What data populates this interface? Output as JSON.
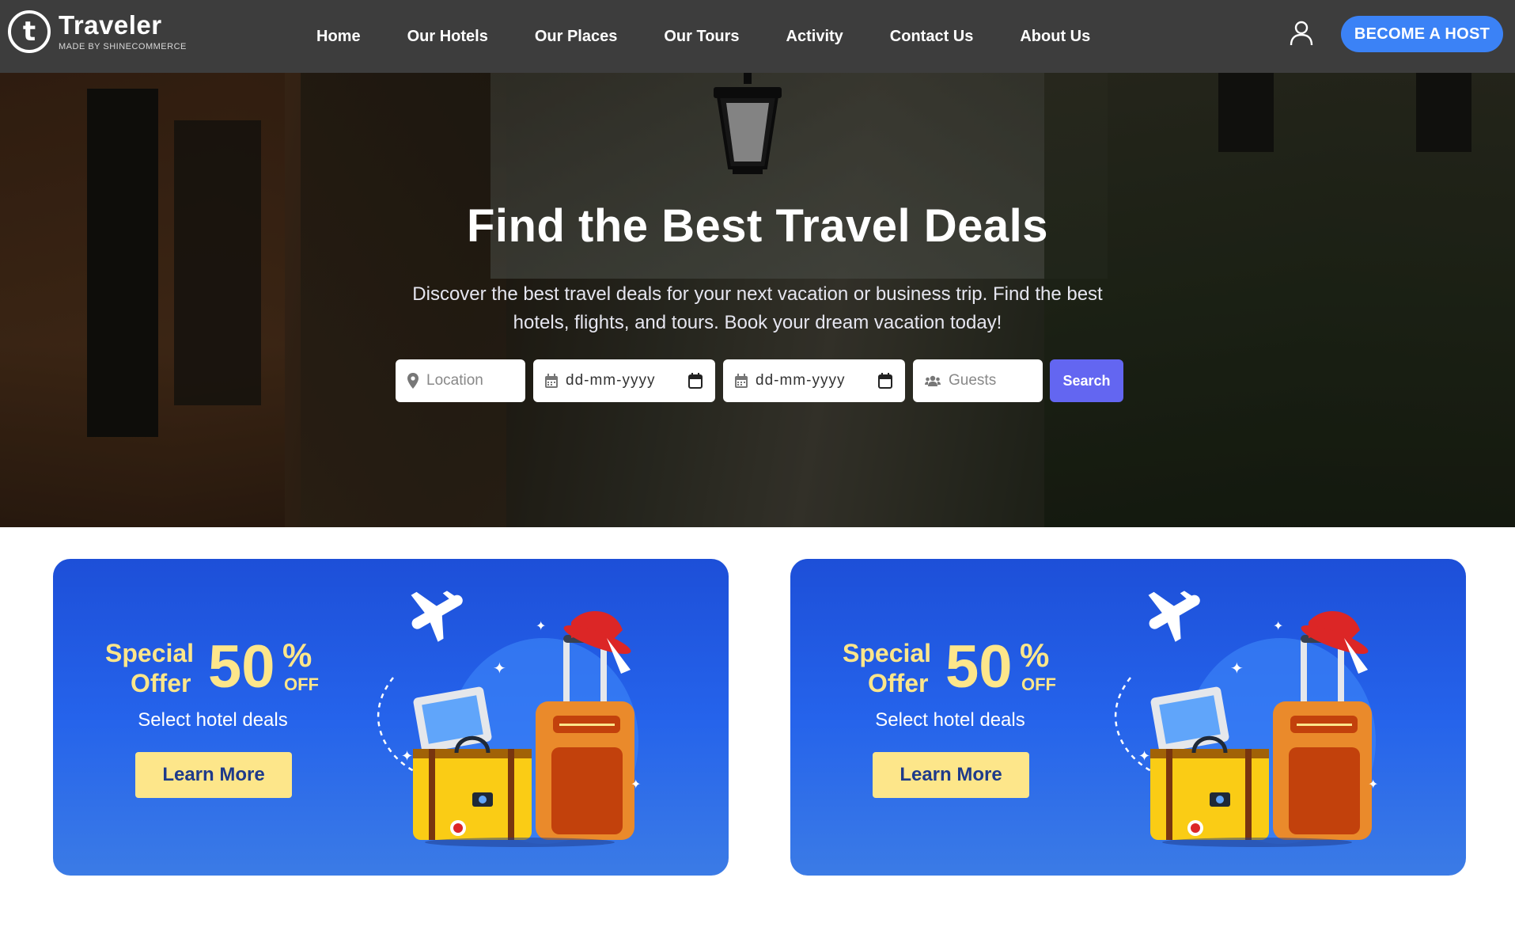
{
  "nav": {
    "logo_letter": "t",
    "logo_name": "Traveler",
    "logo_tagline": "MADE BY SHINECOMMERCE",
    "links": [
      "Home",
      "Our Hotels",
      "Our Places",
      "Our Tours",
      "Activity",
      "Contact Us",
      "About Us"
    ],
    "user_icon": "user-icon",
    "host_button": "BECOME A HOST"
  },
  "hero": {
    "title": "Find the Best Travel Deals",
    "subtitle": "Discover the best travel deals for your next vacation or business trip. Find the best hotels, flights, and tours. Book your dream vacation today!",
    "search": {
      "location_placeholder": "Location",
      "checkin_value": "dd-mm-yyyy",
      "checkout_value": "dd-mm-yyyy",
      "guests_placeholder": "Guests",
      "button": "Search"
    }
  },
  "promos": [
    {
      "special": "Special",
      "offer": "Offer",
      "percent": "50",
      "percent_sign": "%",
      "off": "OFF",
      "caption": "Select hotel deals",
      "button": "Learn More"
    },
    {
      "special": "Special",
      "offer": "Offer",
      "percent": "50",
      "percent_sign": "%",
      "off": "OFF",
      "caption": "Select hotel deals",
      "button": "Learn More"
    }
  ],
  "colors": {
    "navbar": "#3d3d3d",
    "host_button": "#3b82f6",
    "search_button": "#6366f1",
    "promo_bg": "#2563eb",
    "promo_accent": "#fde68a"
  }
}
